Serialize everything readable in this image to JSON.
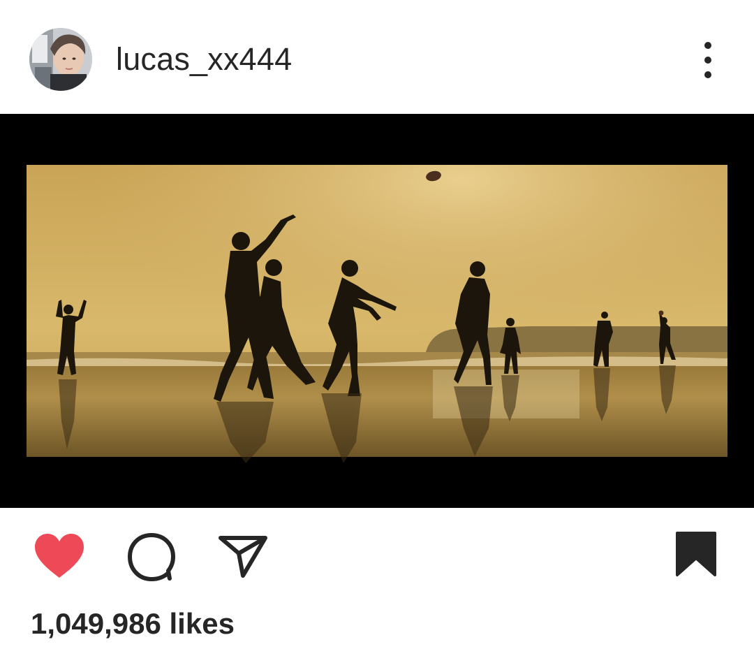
{
  "post": {
    "username": "lucas_xx444",
    "likes_text": "1,049,986 likes"
  },
  "icons": {
    "avatar": "profile-photo",
    "more": "vertical-ellipsis-icon",
    "like": "heart-filled-icon",
    "comment": "speech-bubble-icon",
    "share": "paper-plane-icon",
    "save": "bookmark-filled-icon"
  },
  "colors": {
    "like_active": "#ED4956",
    "text": "#262626",
    "image_letterbox": "#000000"
  }
}
